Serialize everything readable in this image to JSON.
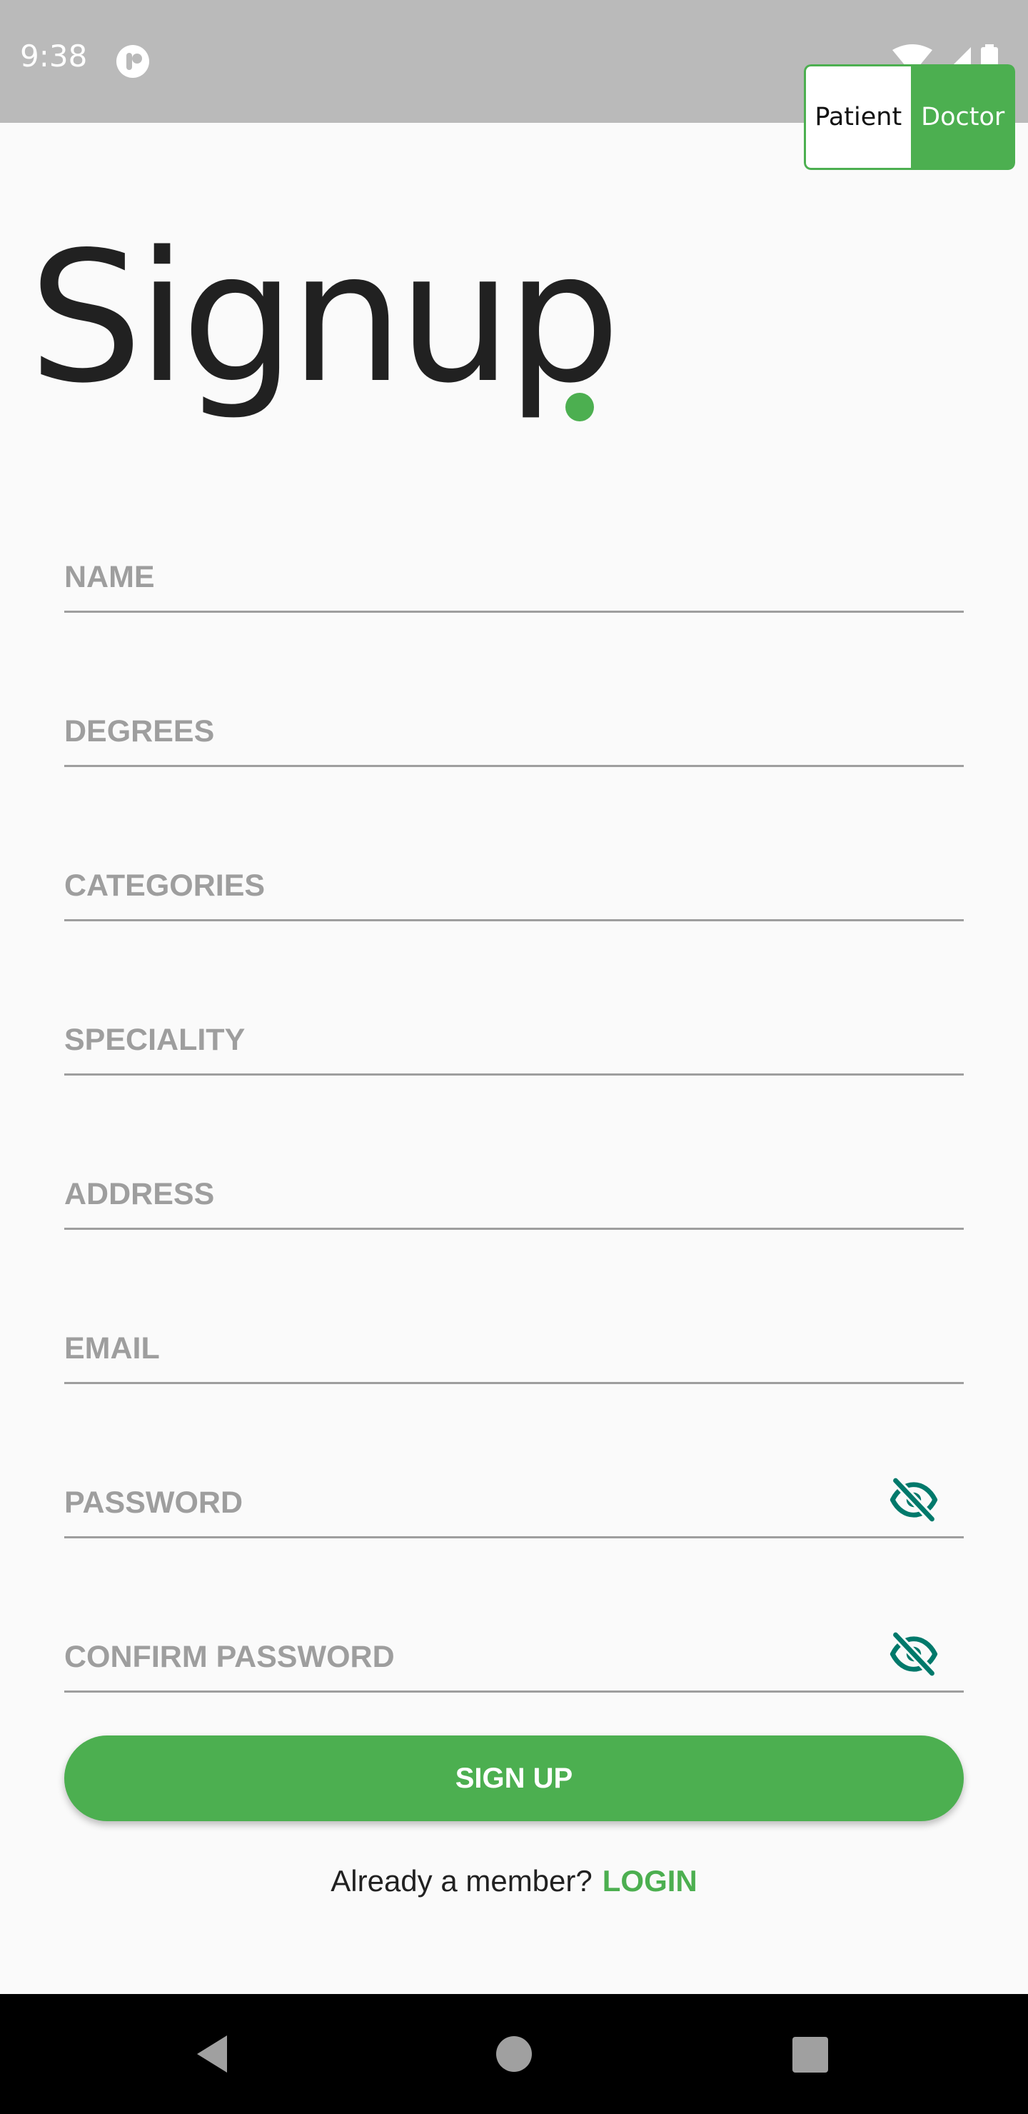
{
  "status_bar": {
    "time": "9:38",
    "icons": [
      "app-notification-icon",
      "wifi-icon",
      "cellular-signal-icon",
      "battery-icon"
    ]
  },
  "role_toggle": {
    "options": [
      "Patient",
      "Doctor"
    ],
    "selected": "Doctor"
  },
  "title": "Signup",
  "form": {
    "name_placeholder": "NAME",
    "degrees_placeholder": "DEGREES",
    "categories_placeholder": "CATEGORIES",
    "speciality_placeholder": "SPECIALITY",
    "address_placeholder": "ADDRESS",
    "email_placeholder": "EMAIL",
    "password_placeholder": "PASSWORD",
    "confirm_password_placeholder": "CONFIRM PASSWORD",
    "password_toggle_icon": "eye-off-icon"
  },
  "signup_button_label": "SIGN UP",
  "login_prompt": "Already a member?",
  "login_link": "LOGIN",
  "nav_bar": {
    "buttons": [
      "back-icon",
      "home-icon",
      "recents-icon"
    ]
  },
  "colors": {
    "accent": "#4caf50",
    "icon_teal": "#00796b",
    "placeholder": "#9e9e9e",
    "title": "#212121",
    "status_bar": "#bababa"
  }
}
